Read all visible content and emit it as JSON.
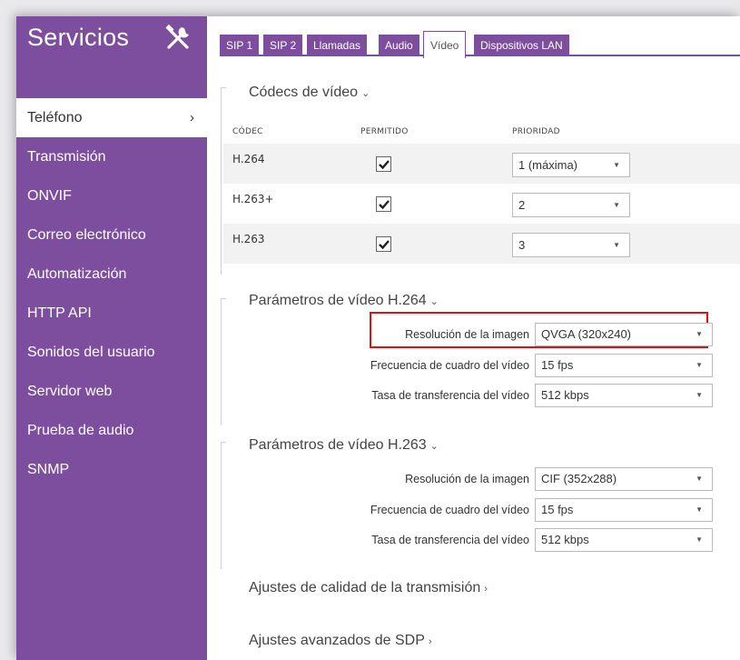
{
  "sidebar": {
    "title": "Servicios",
    "items": [
      {
        "label": "Teléfono",
        "active": true
      },
      {
        "label": "Transmisión"
      },
      {
        "label": "ONVIF"
      },
      {
        "label": "Correo electrónico"
      },
      {
        "label": "Automatización"
      },
      {
        "label": "HTTP API"
      },
      {
        "label": "Sonidos del usuario"
      },
      {
        "label": "Servidor web"
      },
      {
        "label": "Prueba de audio"
      },
      {
        "label": "SNMP"
      }
    ],
    "active_chevron": "›"
  },
  "tabs": [
    {
      "label": "SIP 1"
    },
    {
      "label": "SIP 2"
    },
    {
      "label": "Llamadas"
    },
    {
      "label": "Audio"
    },
    {
      "label": "Vídeo",
      "active": true
    },
    {
      "label": "Dispositivos LAN"
    }
  ],
  "codecs": {
    "title": "Códecs de vídeo",
    "arrow": "⌄",
    "headers": {
      "codec": "CÓDEC",
      "allowed": "PERMITIDO",
      "priority": "PRIORIDAD"
    },
    "rows": [
      {
        "codec": "H.264",
        "allowed": true,
        "priority": "1 (máxima)"
      },
      {
        "codec": "H.263+",
        "allowed": true,
        "priority": "2"
      },
      {
        "codec": "H.263",
        "allowed": true,
        "priority": "3"
      }
    ]
  },
  "h264": {
    "title": "Parámetros de vídeo H.264",
    "arrow": "⌄",
    "resolution_label": "Resolución de la imagen",
    "resolution_value": "QVGA (320x240)",
    "framerate_label": "Frecuencia de cuadro del vídeo",
    "framerate_value": "15 fps",
    "bitrate_label": "Tasa de transferencia del vídeo",
    "bitrate_value": "512 kbps"
  },
  "h263": {
    "title": "Parámetros de vídeo H.263",
    "arrow": "⌄",
    "resolution_label": "Resolución de la imagen",
    "resolution_value": "CIF (352x288)",
    "framerate_label": "Frecuencia de cuadro del vídeo",
    "framerate_value": "15 fps",
    "bitrate_label": "Tasa de transferencia del vídeo",
    "bitrate_value": "512 kbps"
  },
  "quality": {
    "title": "Ajustes de calidad de la transmisión",
    "arrow": "›"
  },
  "sdp": {
    "title": "Ajustes avanzados de SDP",
    "arrow": "›"
  },
  "icons": {
    "tools": "tools-icon",
    "check": "check-icon",
    "caret": "▼"
  },
  "colors": {
    "accent": "#7d4e9e",
    "highlight": "#e01010"
  }
}
